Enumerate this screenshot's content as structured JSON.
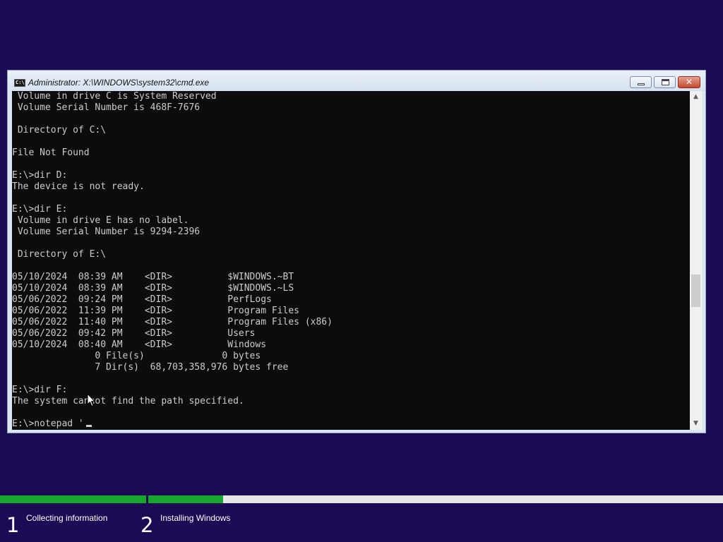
{
  "window": {
    "title": "Administrator: X:\\WINDOWS\\system32\\cmd.exe",
    "icon_text": "C:\\",
    "close_glyph": "✕"
  },
  "console": {
    "lines": [
      " Volume in drive C is System Reserved",
      " Volume Serial Number is 468F-7676",
      "",
      " Directory of C:\\",
      "",
      "File Not Found",
      "",
      "E:\\>dir D:",
      "The device is not ready.",
      "",
      "E:\\>dir E:",
      " Volume in drive E has no label.",
      " Volume Serial Number is 9294-2396",
      "",
      " Directory of E:\\",
      "",
      "05/10/2024  08:39 AM    <DIR>          $WINDOWS.~BT",
      "05/10/2024  08:39 AM    <DIR>          $WINDOWS.~LS",
      "05/06/2022  09:24 PM    <DIR>          PerfLogs",
      "05/06/2022  11:39 PM    <DIR>          Program Files",
      "05/06/2022  11:40 PM    <DIR>          Program Files (x86)",
      "05/06/2022  09:42 PM    <DIR>          Users",
      "05/10/2024  08:40 AM    <DIR>          Windows",
      "               0 File(s)              0 bytes",
      "               7 Dir(s)  68,703,358,976 bytes free",
      "",
      "E:\\>dir F:",
      "The system cannot find the path specified.",
      "",
      "E:\\>notepad '"
    ]
  },
  "scrollbar": {
    "up_glyph": "▲",
    "down_glyph": "▼"
  },
  "setup": {
    "steps": [
      {
        "number": "1",
        "label": "Collecting information",
        "progress": 1.0
      },
      {
        "number": "2",
        "label": "Installing Windows",
        "progress": 0.13
      }
    ]
  },
  "colors": {
    "desktop_bg": "#1c0a54",
    "console_bg": "#0c0c0c",
    "console_text": "#cccccc",
    "progress_fill": "#16a82c",
    "progress_track": "#e6e6e6"
  }
}
